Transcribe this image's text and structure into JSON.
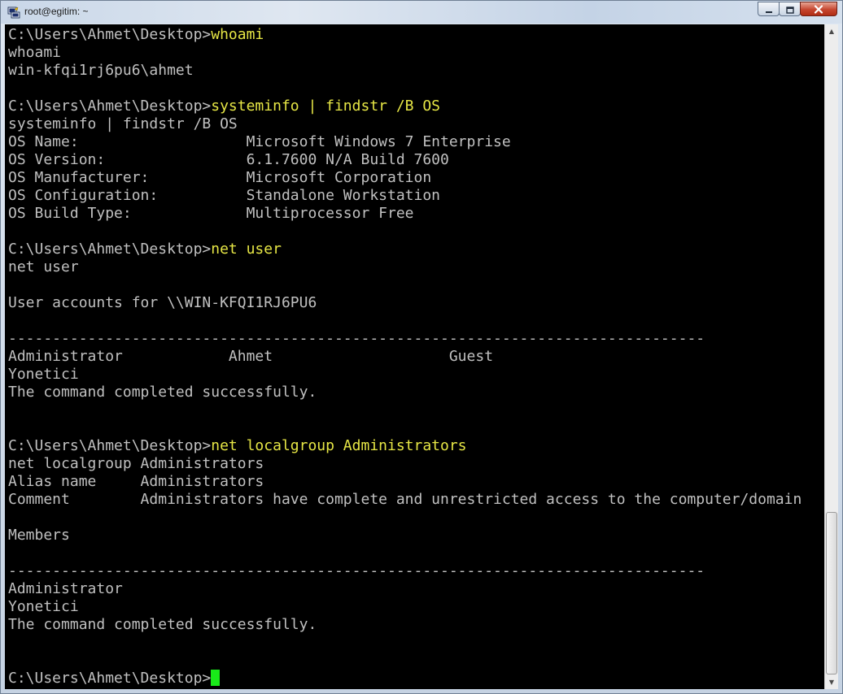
{
  "window": {
    "title": "root@egitim: ~",
    "icon": "putty-terminal-icon",
    "controls": {
      "minimize_icon": "minimize-icon",
      "maximize_icon": "maximize-icon",
      "close_icon": "close-icon"
    }
  },
  "terminal": {
    "colors": {
      "background": "#000000",
      "output": "#c0c0c0",
      "command": "#e6e645",
      "cursor": "#19ea19"
    },
    "lines": [
      {
        "prompt": "C:\\Users\\Ahmet\\Desktop>",
        "cmd": "whoami"
      },
      {
        "text": "whoami"
      },
      {
        "text": "win-kfqi1rj6pu6\\ahmet"
      },
      {
        "text": ""
      },
      {
        "prompt": "C:\\Users\\Ahmet\\Desktop>",
        "cmd": "systeminfo | findstr /B OS"
      },
      {
        "text": "systeminfo | findstr /B OS"
      },
      {
        "text": "OS Name:                   Microsoft Windows 7 Enterprise"
      },
      {
        "text": "OS Version:                6.1.7600 N/A Build 7600"
      },
      {
        "text": "OS Manufacturer:           Microsoft Corporation"
      },
      {
        "text": "OS Configuration:          Standalone Workstation"
      },
      {
        "text": "OS Build Type:             Multiprocessor Free"
      },
      {
        "text": ""
      },
      {
        "prompt": "C:\\Users\\Ahmet\\Desktop>",
        "cmd": "net user"
      },
      {
        "text": "net user"
      },
      {
        "text": ""
      },
      {
        "text": "User accounts for \\\\WIN-KFQI1RJ6PU6"
      },
      {
        "text": ""
      },
      {
        "text": "-------------------------------------------------------------------------------"
      },
      {
        "text": "Administrator            Ahmet                    Guest"
      },
      {
        "text": "Yonetici"
      },
      {
        "text": "The command completed successfully."
      },
      {
        "text": ""
      },
      {
        "text": ""
      },
      {
        "prompt": "C:\\Users\\Ahmet\\Desktop>",
        "cmd": "net localgroup Administrators"
      },
      {
        "text": "net localgroup Administrators"
      },
      {
        "text": "Alias name     Administrators"
      },
      {
        "text": "Comment        Administrators have complete and unrestricted access to the computer/domain"
      },
      {
        "text": ""
      },
      {
        "text": "Members"
      },
      {
        "text": ""
      },
      {
        "text": "-------------------------------------------------------------------------------"
      },
      {
        "text": "Administrator"
      },
      {
        "text": "Yonetici"
      },
      {
        "text": "The command completed successfully."
      },
      {
        "text": ""
      },
      {
        "text": ""
      },
      {
        "prompt": "C:\\Users\\Ahmet\\Desktop>",
        "cmd": "",
        "cursor": true
      }
    ]
  },
  "scrollbar": {
    "up_icon": "scroll-up-arrow-icon",
    "down_icon": "scroll-down-arrow-icon"
  }
}
